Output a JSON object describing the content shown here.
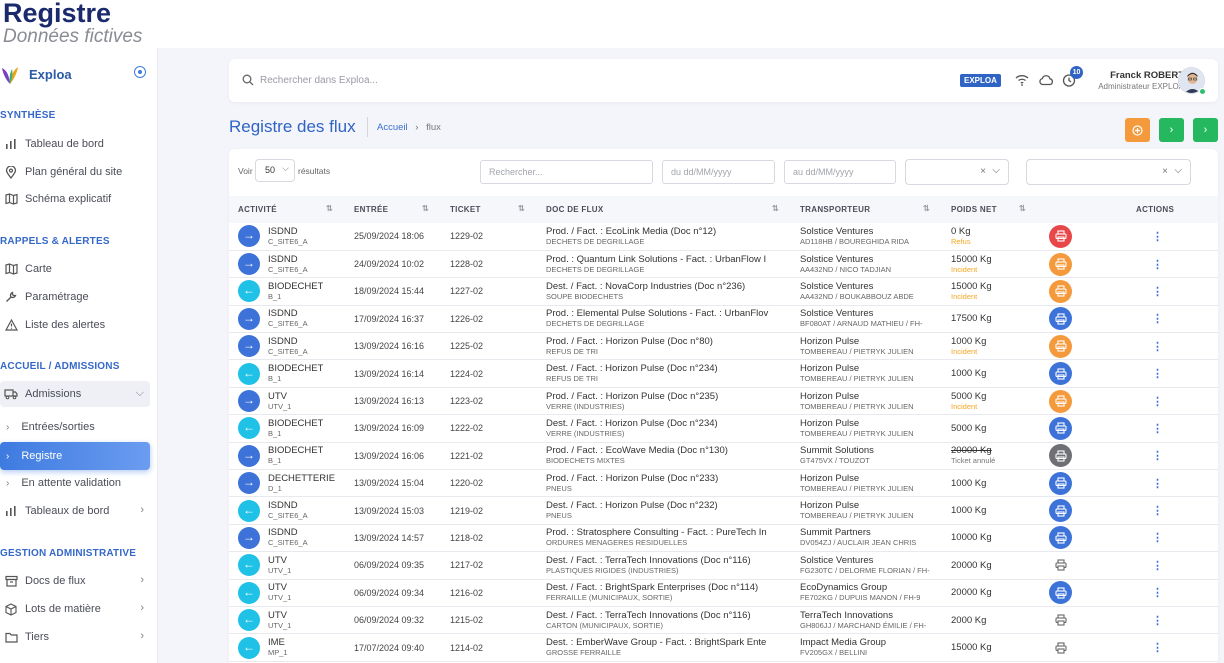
{
  "header": {
    "title": "Registre",
    "subtitle": "Données fictives"
  },
  "brand": {
    "name": "Exploa"
  },
  "sidebar": {
    "sections": [
      {
        "label": "SYNTHÈSE"
      },
      {
        "label": "RAPPELS & ALERTES"
      },
      {
        "label": "ACCUEIL / ADMISSIONS"
      },
      {
        "label": "GESTION ADMINISTRATIVE"
      }
    ],
    "items": [
      {
        "label": "Tableau de bord",
        "icon": "bar-chart-icon"
      },
      {
        "label": "Plan général du site",
        "icon": "map-pin-icon"
      },
      {
        "label": "Schéma explicatif",
        "icon": "map-icon"
      },
      {
        "label": "Carte",
        "icon": "map-icon"
      },
      {
        "label": "Paramétrage",
        "icon": "wrench-icon"
      },
      {
        "label": "Liste des alertes",
        "icon": "warning-icon"
      },
      {
        "label": "Admissions",
        "icon": "truck-icon"
      },
      {
        "label": "Entrées/sorties"
      },
      {
        "label": "Registre"
      },
      {
        "label": "En attente validation"
      },
      {
        "label": "Tableaux de bord",
        "icon": "bar-chart-icon"
      },
      {
        "label": "Docs de flux",
        "icon": "archive-icon"
      },
      {
        "label": "Lots de matière",
        "icon": "cube-icon"
      },
      {
        "label": "Tiers",
        "icon": "folder-icon"
      }
    ]
  },
  "topbar": {
    "search_placeholder": "Rechercher dans Exploa...",
    "badge": "EXPLOA",
    "notifications": "10",
    "user_name": "Franck ROBERT",
    "user_role": "Administrateur EXPLOA"
  },
  "page": {
    "title": "Registre des flux",
    "breadcrumb_home": "Accueil",
    "breadcrumb_sep": "›",
    "breadcrumb_current": "flux"
  },
  "filters": {
    "show_label": "Voir",
    "entries_value": "50",
    "results_label": "résultats",
    "search_placeholder": "Rechercher...",
    "from_placeholder": "du dd/MM/yyyy",
    "to_placeholder": "au dd/MM/yyyy"
  },
  "table": {
    "columns": [
      "ACTIVITÉ",
      "ENTRÉE",
      "TICKET",
      "DOC DE FLUX",
      "TRANSPORTEUR",
      "POIDS NET",
      "",
      "ACTIONS"
    ],
    "rows": [
      {
        "dir": "out",
        "act": "ISDND",
        "site": "C_SITE6_A",
        "date": "25/09/2024 18:06",
        "ticket": "1229-02",
        "doc": "Prod. / Fact. : EcoLink Media (Doc n°12)",
        "doc2": "DECHETS DE DEGRILLAGE",
        "tr": "Solstice Ventures",
        "tr2": "AD118HB / BOUREGHIDA RIDA",
        "poids": "0 Kg",
        "status": "Refus",
        "stype": "orange",
        "print": "#e8474a"
      },
      {
        "dir": "out",
        "act": "ISDND",
        "site": "C_SITE6_A",
        "date": "24/09/2024 10:02",
        "ticket": "1228-02",
        "doc": "Prod. : Quantum Link Solutions - Fact. : UrbanFlow I",
        "doc2": "DECHETS DE DEGRILLAGE",
        "tr": "Solstice Ventures",
        "tr2": "AA432ND / NICO TADJIAN",
        "poids": "15000 Kg",
        "status": "Incident",
        "stype": "orange",
        "print": "#f59a3c"
      },
      {
        "dir": "in",
        "act": "BIODECHET",
        "site": "B_1",
        "date": "18/09/2024 15:44",
        "ticket": "1227-02",
        "doc": "Dest. / Fact. : NovaCorp Industries (Doc n°236)",
        "doc2": "SOUPE BIODECHETS",
        "tr": "Solstice Ventures",
        "tr2": "AA432ND / BOUKABBOUZ ABDE",
        "poids": "15000 Kg",
        "status": "Incident",
        "stype": "orange",
        "print": "#f59a3c"
      },
      {
        "dir": "out",
        "act": "ISDND",
        "site": "C_SITE6_A",
        "date": "17/09/2024 16:37",
        "ticket": "1226-02",
        "doc": "Prod. : Elemental Pulse Solutions - Fact. : UrbanFlov",
        "doc2": "DECHETS DE DEGRILLAGE",
        "tr": "Solstice Ventures",
        "tr2": "BF080AT / Arnaud Mathieu / FH-",
        "poids": "17500 Kg",
        "status": "",
        "stype": "",
        "print": "#3d73d9"
      },
      {
        "dir": "out",
        "act": "ISDND",
        "site": "C_SITE6_A",
        "date": "13/09/2024 16:16",
        "ticket": "1225-02",
        "doc": "Prod. / Fact. : Horizon Pulse (Doc n°80)",
        "doc2": "REFUS DE TRI",
        "tr": "Horizon Pulse",
        "tr2": "TOMBEREAU / PIETRYK JULIEN",
        "poids": "1000 Kg",
        "status": "Incident",
        "stype": "orange",
        "print": "#f59a3c"
      },
      {
        "dir": "in",
        "act": "BIODECHET",
        "site": "B_1",
        "date": "13/09/2024 16:14",
        "ticket": "1224-02",
        "doc": "Dest. / Fact. : Horizon Pulse (Doc n°234)",
        "doc2": "REFUS DE TRI",
        "tr": "Horizon Pulse",
        "tr2": "TOMBEREAU / PIETRYK JULIEN",
        "poids": "1000 Kg",
        "status": "",
        "stype": "",
        "print": "#3d73d9"
      },
      {
        "dir": "out",
        "act": "UTV",
        "site": "UTV_1",
        "date": "13/09/2024 16:13",
        "ticket": "1223-02",
        "doc": "Prod. / Fact. : Horizon Pulse (Doc n°235)",
        "doc2": "VERRE (industries)",
        "tr": "Horizon Pulse",
        "tr2": "TOMBEREAU / PIETRYK JULIEN",
        "poids": "5000 Kg",
        "status": "Incident",
        "stype": "orange",
        "print": "#f59a3c"
      },
      {
        "dir": "in",
        "act": "BIODECHET",
        "site": "B_1",
        "date": "13/09/2024 16:09",
        "ticket": "1222-02",
        "doc": "Dest. / Fact. : Horizon Pulse (Doc n°234)",
        "doc2": "VERRE (industries)",
        "tr": "Horizon Pulse",
        "tr2": "TOMBEREAU / PIETRYK JULIEN",
        "poids": "5000 Kg",
        "status": "",
        "stype": "",
        "print": "#3d73d9"
      },
      {
        "dir": "out",
        "act": "BIODECHET",
        "site": "B_1",
        "date": "13/09/2024 16:06",
        "ticket": "1221-02",
        "doc": "Prod. / Fact. : EcoWave Media (Doc n°130)",
        "doc2": "BIODECHETS MIXTES",
        "tr": "Summit Solutions",
        "tr2": "GT475VX / TOUZOT",
        "poids": "20000 Kg",
        "status": "Ticket annulé",
        "stype": "gray",
        "print": "#6e7075"
      },
      {
        "dir": "out",
        "act": "DECHETTERIE",
        "site": "D_1",
        "date": "13/09/2024 15:04",
        "ticket": "1220-02",
        "doc": "Prod. / Fact. : Horizon Pulse (Doc n°233)",
        "doc2": "PNEUS",
        "tr": "Horizon Pulse",
        "tr2": "TOMBEREAU / PIETRYK JULIEN",
        "poids": "1000 Kg",
        "status": "",
        "stype": "",
        "print": "#3d73d9"
      },
      {
        "dir": "in",
        "act": "ISDND",
        "site": "C_SITE6_A",
        "date": "13/09/2024 15:03",
        "ticket": "1219-02",
        "doc": "Dest. / Fact. : Horizon Pulse (Doc n°232)",
        "doc2": "PNEUS",
        "tr": "Horizon Pulse",
        "tr2": "TOMBEREAU / PIETRYK JULIEN",
        "poids": "1000 Kg",
        "status": "",
        "stype": "",
        "print": "#3d73d9"
      },
      {
        "dir": "out",
        "act": "ISDND",
        "site": "C_SITE6_A",
        "date": "13/09/2024 14:57",
        "ticket": "1218-02",
        "doc": "Prod. : Stratosphere Consulting - Fact. : PureTech In",
        "doc2": "ORDURES MENAGERES RESIDUELLES",
        "tr": "Summit Partners",
        "tr2": "DV054ZJ / AUCLAIR JEAN CHRIS",
        "poids": "10000 Kg",
        "status": "",
        "stype": "",
        "print": "#3d73d9"
      },
      {
        "dir": "in",
        "act": "UTV",
        "site": "UTV_1",
        "date": "06/09/2024 09:35",
        "ticket": "1217-02",
        "doc": "Dest. / Fact. : TerraTech Innovations (Doc n°116)",
        "doc2": "PLASTIQUES RIGIDES (industries)",
        "tr": "Solstice Ventures",
        "tr2": "FG230TC / Delorme Florian / FH-",
        "poids": "20000 Kg",
        "status": "",
        "stype": "",
        "print": ""
      },
      {
        "dir": "in",
        "act": "UTV",
        "site": "UTV_1",
        "date": "06/09/2024 09:34",
        "ticket": "1216-02",
        "doc": "Dest. / Fact. : BrightSpark Enterprises (Doc n°114)",
        "doc2": "FERRAILLE (municipaux, sortie)",
        "tr": "EcoDynamics Group",
        "tr2": "FE702KG / Dupuis Manon / FH-9",
        "poids": "20000 Kg",
        "status": "",
        "stype": "",
        "print": "#3d73d9"
      },
      {
        "dir": "in",
        "act": "UTV",
        "site": "UTV_1",
        "date": "06/09/2024 09:32",
        "ticket": "1215-02",
        "doc": "Dest. / Fact. : TerraTech Innovations (Doc n°116)",
        "doc2": "CARTON (municipaux, sortie)",
        "tr": "TerraTech Innovations",
        "tr2": "GH806JJ / Marchand Émilie / FH-",
        "poids": "2000 Kg",
        "status": "",
        "stype": "",
        "print": ""
      },
      {
        "dir": "in",
        "act": "IME",
        "site": "MP_1",
        "date": "17/07/2024 09:40",
        "ticket": "1214-02",
        "doc": "Dest. : EmberWave Group - Fact. : BrightSpark Ente",
        "doc2": "GROSSE FERRAILLE",
        "tr": "Impact Media Group",
        "tr2": "FV205GX / BELLINI",
        "poids": "15000 Kg",
        "status": "",
        "stype": "",
        "print": ""
      }
    ]
  }
}
